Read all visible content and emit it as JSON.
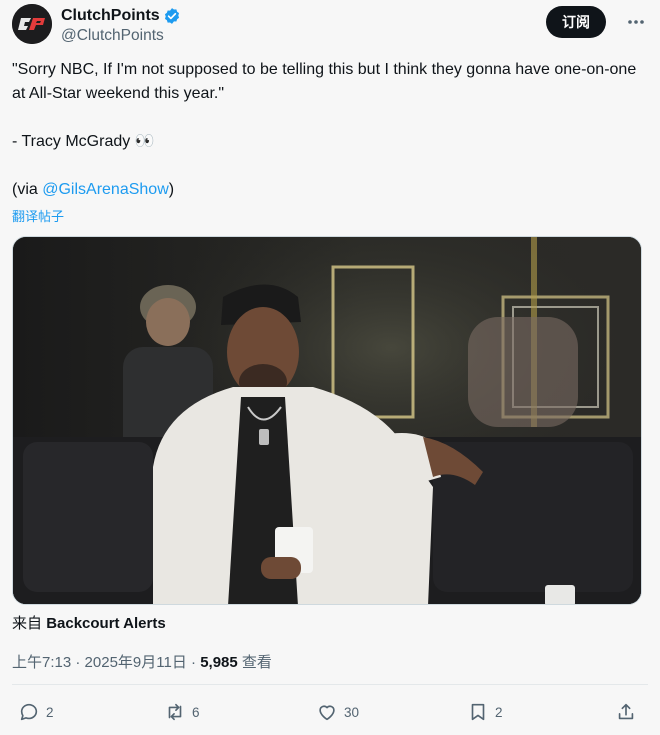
{
  "header": {
    "display_name": "ClutchPoints",
    "handle": "@ClutchPoints",
    "subscribe_label": "订阅",
    "avatar_icon": "clutchpoints-logo-icon"
  },
  "tweet": {
    "line1": "\"Sorry NBC, If I'm not supposed to be telling this but I think they gonna have one-on-one at All-Star weekend this year.\"",
    "line2": "- Tracy McGrady 👀",
    "via_prefix": "(via ",
    "via_mention": "@GilsArenaShow",
    "via_suffix": ")",
    "translate": "翻译帖子"
  },
  "media": {
    "description_icon": "video-thumbnail"
  },
  "source": {
    "prefix": "来自",
    "name": "Backcourt Alerts"
  },
  "meta": {
    "time": "上午7:13",
    "date": "2025年9月11日",
    "views": "5,985",
    "views_label": "查看"
  },
  "actions": {
    "replies": "2",
    "reposts": "6",
    "likes": "30",
    "bookmarks": "2"
  },
  "colors": {
    "accent": "#1d9bf0",
    "text": "#0f1419",
    "muted": "#536471"
  }
}
